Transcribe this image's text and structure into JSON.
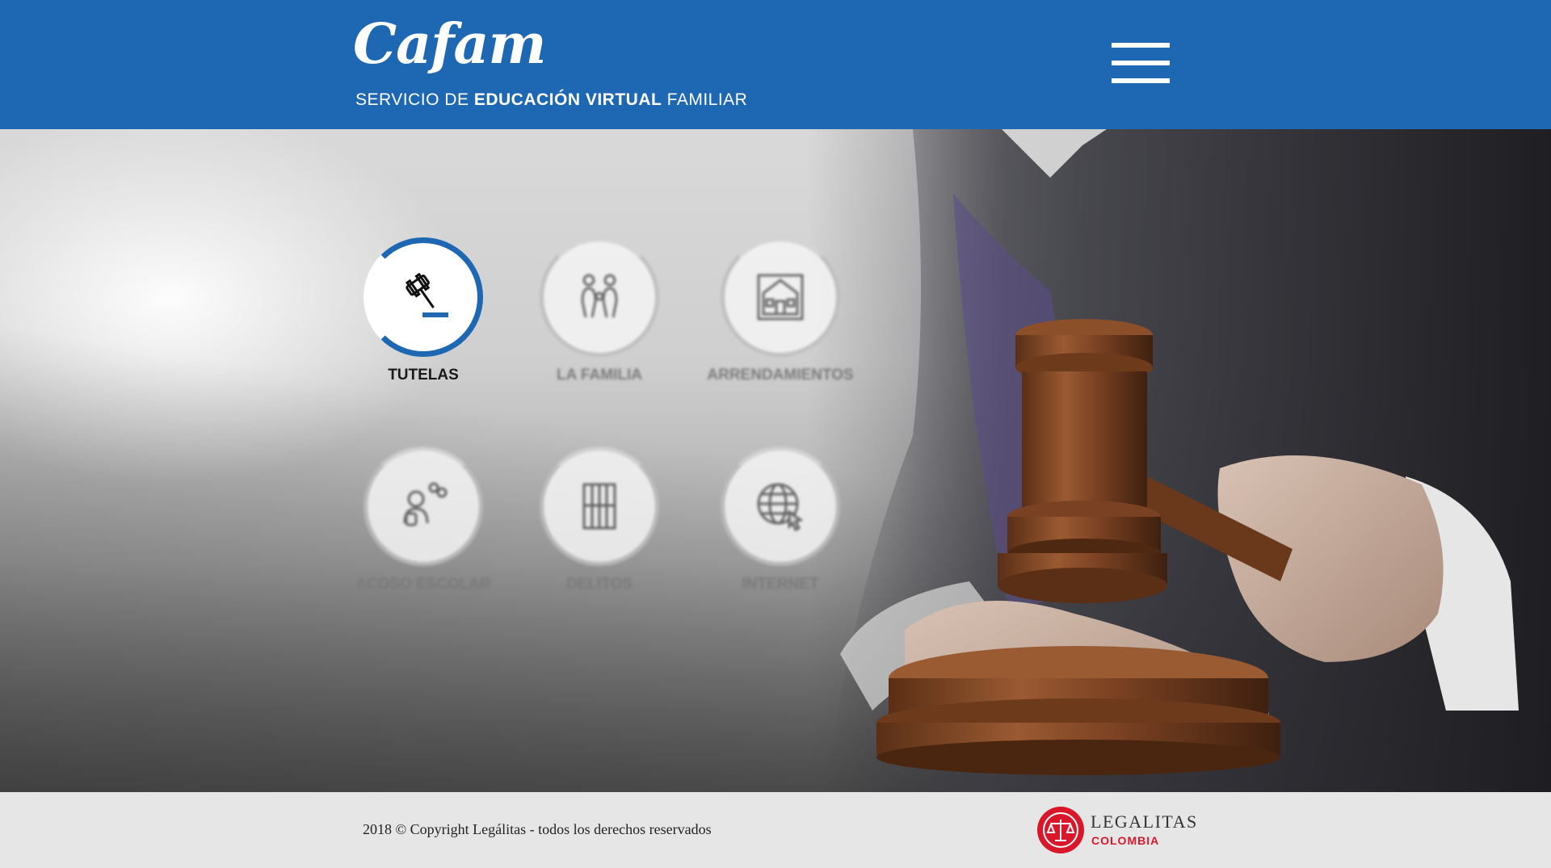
{
  "header": {
    "logo_text": "Cafam",
    "tagline_prefix": "SERVICIO DE ",
    "tagline_bold": "EDUCACIÓN VIRTUAL",
    "tagline_suffix": " FAMILIAR",
    "menu_icon": "hamburger-menu-icon"
  },
  "topics": [
    {
      "label": "TUTELAS",
      "icon": "gavel-icon",
      "active": true
    },
    {
      "label": "LA FAMILIA",
      "icon": "family-icon",
      "active": false
    },
    {
      "label": "ARRENDAMIENTOS",
      "icon": "house-icon",
      "active": false
    },
    {
      "label": "ACOSO ESCOLAR",
      "icon": "bullying-icon",
      "active": false
    },
    {
      "label": "DELITOS",
      "icon": "jail-icon",
      "active": false
    },
    {
      "label": "INTERNET",
      "icon": "globe-cursor-icon",
      "active": false
    }
  ],
  "footer": {
    "copyright": "2018 © Copyright Legálitas - todos los derechos reservados",
    "partner_name": "LEGALITAS",
    "partner_country": "COLOMBIA",
    "partner_icon": "scales-of-justice-icon"
  },
  "colors": {
    "brand_blue": "#1e67b2",
    "footer_bg": "#e6e6e6",
    "partner_red": "#d8172a"
  }
}
